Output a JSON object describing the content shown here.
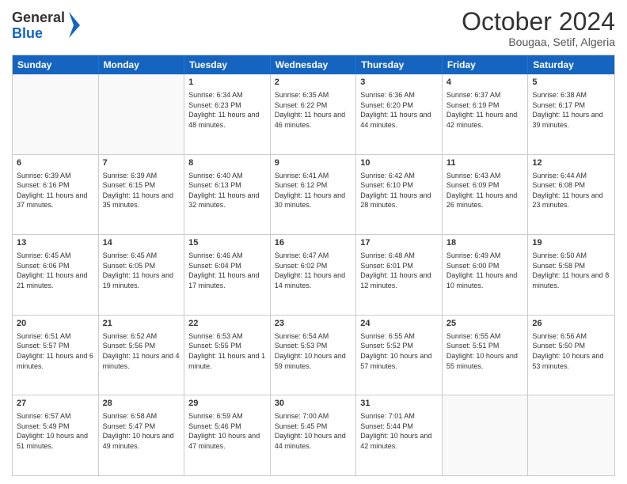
{
  "header": {
    "logo_line1": "General",
    "logo_line2": "Blue",
    "month_title": "October 2024",
    "location": "Bougaa, Setif, Algeria"
  },
  "day_headers": [
    "Sunday",
    "Monday",
    "Tuesday",
    "Wednesday",
    "Thursday",
    "Friday",
    "Saturday"
  ],
  "weeks": [
    [
      {
        "num": "",
        "info": ""
      },
      {
        "num": "",
        "info": ""
      },
      {
        "num": "1",
        "info": "Sunrise: 6:34 AM\nSunset: 6:23 PM\nDaylight: 11 hours and 48 minutes."
      },
      {
        "num": "2",
        "info": "Sunrise: 6:35 AM\nSunset: 6:22 PM\nDaylight: 11 hours and 46 minutes."
      },
      {
        "num": "3",
        "info": "Sunrise: 6:36 AM\nSunset: 6:20 PM\nDaylight: 11 hours and 44 minutes."
      },
      {
        "num": "4",
        "info": "Sunrise: 6:37 AM\nSunset: 6:19 PM\nDaylight: 11 hours and 42 minutes."
      },
      {
        "num": "5",
        "info": "Sunrise: 6:38 AM\nSunset: 6:17 PM\nDaylight: 11 hours and 39 minutes."
      }
    ],
    [
      {
        "num": "6",
        "info": "Sunrise: 6:39 AM\nSunset: 6:16 PM\nDaylight: 11 hours and 37 minutes."
      },
      {
        "num": "7",
        "info": "Sunrise: 6:39 AM\nSunset: 6:15 PM\nDaylight: 11 hours and 35 minutes."
      },
      {
        "num": "8",
        "info": "Sunrise: 6:40 AM\nSunset: 6:13 PM\nDaylight: 11 hours and 32 minutes."
      },
      {
        "num": "9",
        "info": "Sunrise: 6:41 AM\nSunset: 6:12 PM\nDaylight: 11 hours and 30 minutes."
      },
      {
        "num": "10",
        "info": "Sunrise: 6:42 AM\nSunset: 6:10 PM\nDaylight: 11 hours and 28 minutes."
      },
      {
        "num": "11",
        "info": "Sunrise: 6:43 AM\nSunset: 6:09 PM\nDaylight: 11 hours and 26 minutes."
      },
      {
        "num": "12",
        "info": "Sunrise: 6:44 AM\nSunset: 6:08 PM\nDaylight: 11 hours and 23 minutes."
      }
    ],
    [
      {
        "num": "13",
        "info": "Sunrise: 6:45 AM\nSunset: 6:06 PM\nDaylight: 11 hours and 21 minutes."
      },
      {
        "num": "14",
        "info": "Sunrise: 6:45 AM\nSunset: 6:05 PM\nDaylight: 11 hours and 19 minutes."
      },
      {
        "num": "15",
        "info": "Sunrise: 6:46 AM\nSunset: 6:04 PM\nDaylight: 11 hours and 17 minutes."
      },
      {
        "num": "16",
        "info": "Sunrise: 6:47 AM\nSunset: 6:02 PM\nDaylight: 11 hours and 14 minutes."
      },
      {
        "num": "17",
        "info": "Sunrise: 6:48 AM\nSunset: 6:01 PM\nDaylight: 11 hours and 12 minutes."
      },
      {
        "num": "18",
        "info": "Sunrise: 6:49 AM\nSunset: 6:00 PM\nDaylight: 11 hours and 10 minutes."
      },
      {
        "num": "19",
        "info": "Sunrise: 6:50 AM\nSunset: 5:58 PM\nDaylight: 11 hours and 8 minutes."
      }
    ],
    [
      {
        "num": "20",
        "info": "Sunrise: 6:51 AM\nSunset: 5:57 PM\nDaylight: 11 hours and 6 minutes."
      },
      {
        "num": "21",
        "info": "Sunrise: 6:52 AM\nSunset: 5:56 PM\nDaylight: 11 hours and 4 minutes."
      },
      {
        "num": "22",
        "info": "Sunrise: 6:53 AM\nSunset: 5:55 PM\nDaylight: 11 hours and 1 minute."
      },
      {
        "num": "23",
        "info": "Sunrise: 6:54 AM\nSunset: 5:53 PM\nDaylight: 10 hours and 59 minutes."
      },
      {
        "num": "24",
        "info": "Sunrise: 6:55 AM\nSunset: 5:52 PM\nDaylight: 10 hours and 57 minutes."
      },
      {
        "num": "25",
        "info": "Sunrise: 6:55 AM\nSunset: 5:51 PM\nDaylight: 10 hours and 55 minutes."
      },
      {
        "num": "26",
        "info": "Sunrise: 6:56 AM\nSunset: 5:50 PM\nDaylight: 10 hours and 53 minutes."
      }
    ],
    [
      {
        "num": "27",
        "info": "Sunrise: 6:57 AM\nSunset: 5:49 PM\nDaylight: 10 hours and 51 minutes."
      },
      {
        "num": "28",
        "info": "Sunrise: 6:58 AM\nSunset: 5:47 PM\nDaylight: 10 hours and 49 minutes."
      },
      {
        "num": "29",
        "info": "Sunrise: 6:59 AM\nSunset: 5:46 PM\nDaylight: 10 hours and 47 minutes."
      },
      {
        "num": "30",
        "info": "Sunrise: 7:00 AM\nSunset: 5:45 PM\nDaylight: 10 hours and 44 minutes."
      },
      {
        "num": "31",
        "info": "Sunrise: 7:01 AM\nSunset: 5:44 PM\nDaylight: 10 hours and 42 minutes."
      },
      {
        "num": "",
        "info": ""
      },
      {
        "num": "",
        "info": ""
      }
    ]
  ]
}
